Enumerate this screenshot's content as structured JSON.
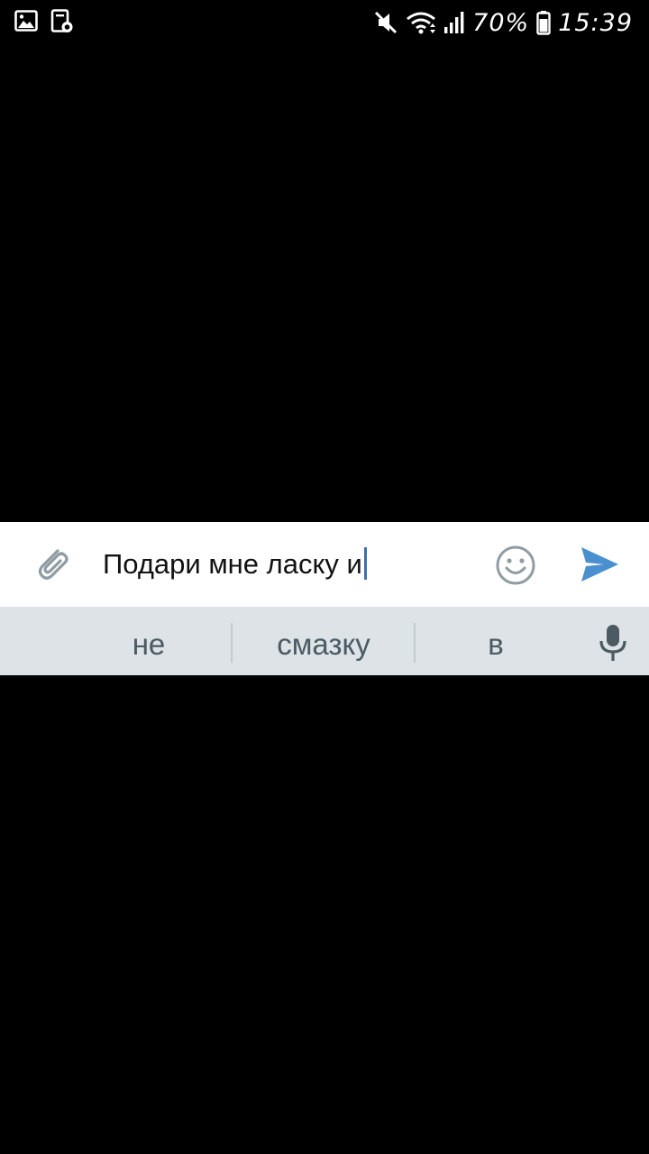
{
  "status_bar": {
    "left_icons": [
      "gallery-icon",
      "screenshot-icon"
    ],
    "right_icons": [
      "mute-icon",
      "wifi-icon",
      "signal-icon",
      "battery-icon"
    ],
    "battery": "70%",
    "time": "15:39"
  },
  "composer": {
    "icons": {
      "attach": "paperclip-icon",
      "emoji": "smiley-icon",
      "send": "send-icon"
    },
    "input_value": "Подари мне ласку и",
    "accent_color": "#4a8fd0"
  },
  "suggestions": {
    "items": [
      "не",
      "смазку",
      "в"
    ],
    "voice_icon": "microphone-icon"
  }
}
